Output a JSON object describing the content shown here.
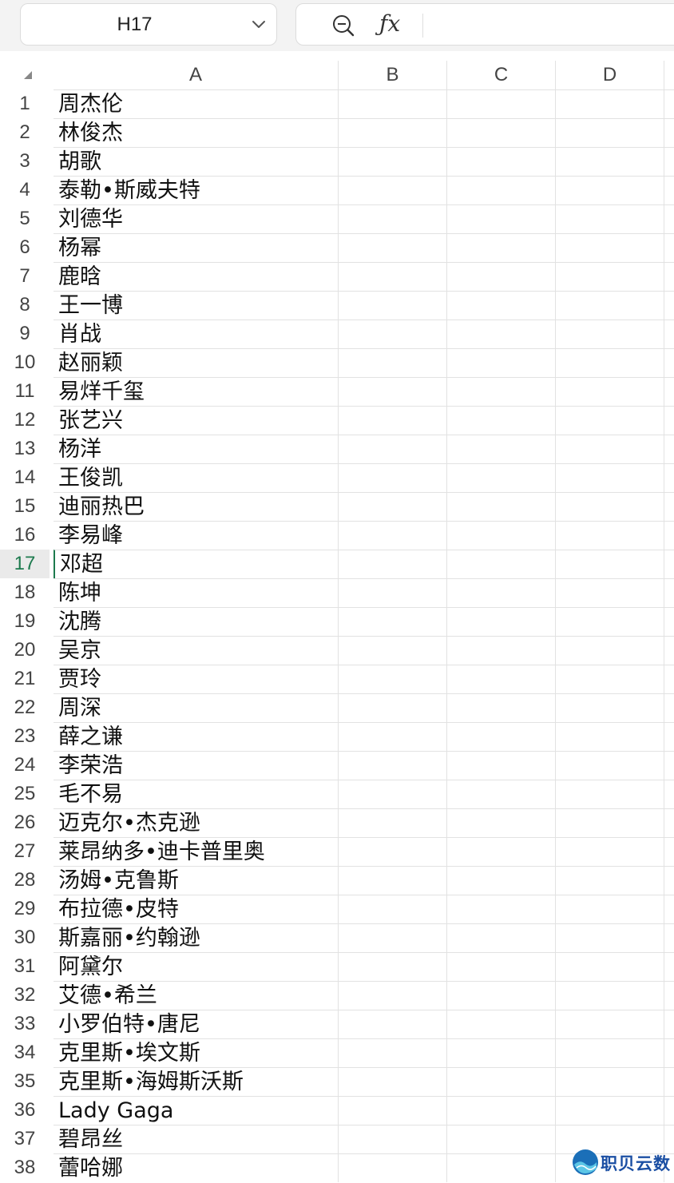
{
  "name_box": {
    "cell_ref": "H17"
  },
  "formula_bar": {
    "value": ""
  },
  "columns": [
    "A",
    "B",
    "C",
    "D"
  ],
  "selected_row": 17,
  "rows": [
    {
      "n": "1",
      "a": "周杰伦"
    },
    {
      "n": "2",
      "a": "林俊杰"
    },
    {
      "n": "3",
      "a": "胡歌"
    },
    {
      "n": "4",
      "a": "泰勒•斯威夫特"
    },
    {
      "n": "5",
      "a": "刘德华"
    },
    {
      "n": "6",
      "a": "杨幂"
    },
    {
      "n": "7",
      "a": "鹿晗"
    },
    {
      "n": "8",
      "a": "王一博"
    },
    {
      "n": "9",
      "a": "肖战"
    },
    {
      "n": "10",
      "a": "赵丽颖"
    },
    {
      "n": "11",
      "a": "易烊千玺"
    },
    {
      "n": "12",
      "a": "张艺兴"
    },
    {
      "n": "13",
      "a": "杨洋"
    },
    {
      "n": "14",
      "a": "王俊凯"
    },
    {
      "n": "15",
      "a": "迪丽热巴"
    },
    {
      "n": "16",
      "a": "李易峰"
    },
    {
      "n": "17",
      "a": "邓超"
    },
    {
      "n": "18",
      "a": "陈坤"
    },
    {
      "n": "19",
      "a": "沈腾"
    },
    {
      "n": "20",
      "a": "吴京"
    },
    {
      "n": "21",
      "a": "贾玲"
    },
    {
      "n": "22",
      "a": "周深"
    },
    {
      "n": "23",
      "a": "薛之谦"
    },
    {
      "n": "24",
      "a": "李荣浩"
    },
    {
      "n": "25",
      "a": "毛不易"
    },
    {
      "n": "26",
      "a": "迈克尔•杰克逊"
    },
    {
      "n": "27",
      "a": "莱昂纳多•迪卡普里奥"
    },
    {
      "n": "28",
      "a": "汤姆•克鲁斯"
    },
    {
      "n": "29",
      "a": "布拉德•皮特"
    },
    {
      "n": "30",
      "a": "斯嘉丽•约翰逊"
    },
    {
      "n": "31",
      "a": "阿黛尔"
    },
    {
      "n": "32",
      "a": "艾德•希兰"
    },
    {
      "n": "33",
      "a": "小罗伯特•唐尼"
    },
    {
      "n": "34",
      "a": "克里斯•埃文斯"
    },
    {
      "n": "35",
      "a": "克里斯•海姆斯沃斯"
    },
    {
      "n": "36",
      "a": "Lady Gaga"
    },
    {
      "n": "37",
      "a": "碧昂丝"
    },
    {
      "n": "38",
      "a": "蕾哈娜"
    }
  ],
  "watermark": {
    "text": "职贝云数"
  },
  "colors": {
    "accent": "#1d7a4e",
    "gridline": "#e2e2e2",
    "toolbar_bg": "#f3f3f3"
  }
}
